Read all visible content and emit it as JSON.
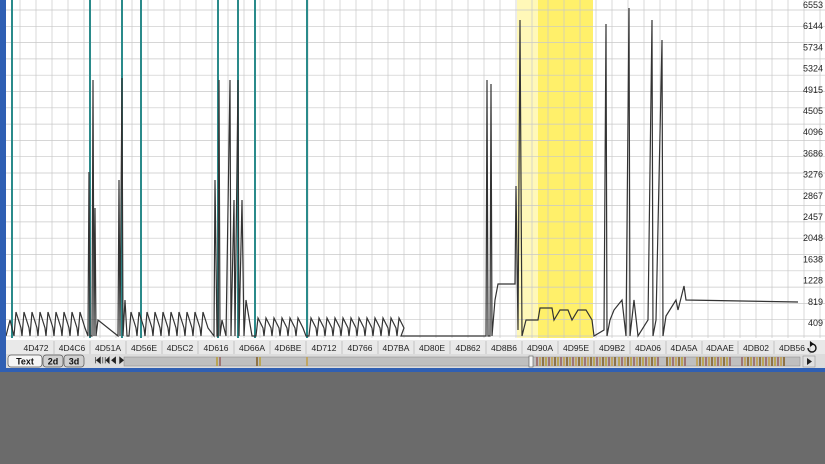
{
  "colors": {
    "frame": "#2f5fb3",
    "grid": "#c8c8c8",
    "trace": "#333333",
    "marker": "#2a8a8a",
    "highlight": "#fff06a",
    "highlight_soft": "#fff8b8",
    "desktop": "#6b6b6b"
  },
  "y_axis_labels": [
    "6553",
    "6144",
    "5734",
    "5324",
    "4915",
    "4505",
    "4096",
    "3686",
    "3276",
    "2867",
    "2457",
    "2048",
    "1638",
    "1228",
    "819",
    "409"
  ],
  "x_axis_labels": [
    "4D472",
    "4D4C6",
    "4D51A",
    "4D56E",
    "4D5C2",
    "4D616",
    "4D66A",
    "4D6BE",
    "4D712",
    "4D766",
    "4D7BA",
    "4D80E",
    "4D862",
    "4D8B6",
    "4D90A",
    "4D95E",
    "4D9B2",
    "4DA06",
    "4DA5A",
    "4DAAE",
    "4DB02",
    "4DB56"
  ],
  "view_tabs": [
    {
      "label": "Text",
      "active": true
    },
    {
      "label": "2d",
      "active": false
    },
    {
      "label": "3d",
      "active": false
    }
  ],
  "nav_icons": [
    "nav-first-icon",
    "nav-prev-icon",
    "nav-left-icon",
    "nav-right-icon"
  ],
  "corner_icon": "undo-arrow-icon",
  "scroll_arrow_icon": "scroll-right-icon"
}
